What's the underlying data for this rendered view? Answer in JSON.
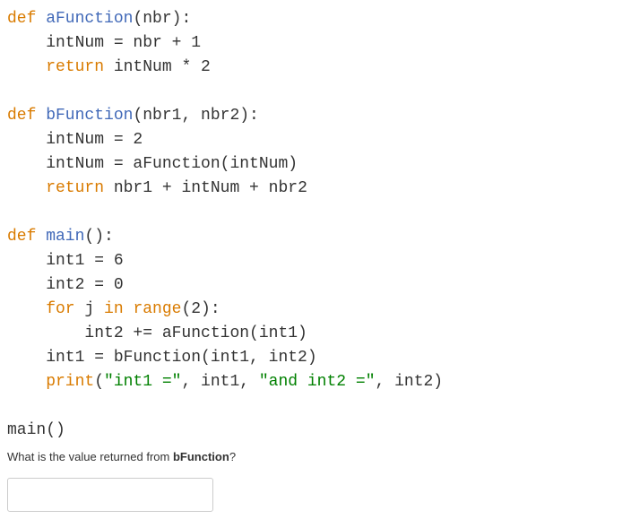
{
  "code": {
    "l1_def": "def",
    "l1_fn": " aFunction",
    "l1_rest": "(nbr):",
    "l2": "    intNum = nbr + 1",
    "l3_ret": "    return",
    "l3_rest": " intNum * 2",
    "l4": "",
    "l5_def": "def",
    "l5_fn": " bFunction",
    "l5_rest": "(nbr1, nbr2):",
    "l6": "    intNum = 2",
    "l7": "    intNum = aFunction(intNum)",
    "l8_ret": "    return",
    "l8_rest": " nbr1 + intNum + nbr2",
    "l9": "",
    "l10_def": "def",
    "l10_fn": " main",
    "l10_rest": "():",
    "l11": "    int1 = 6",
    "l12": "    int2 = 0",
    "l13_for": "    for",
    "l13_j": " j",
    "l13_in": " in",
    "l13_range": " range",
    "l13_rest": "(2):",
    "l14": "        int2 += aFunction(int1)",
    "l15": "    int1 = bFunction(int1, int2)",
    "l16_print": "    print",
    "l16_pa": "(",
    "l16_s1": "\"int1 =\"",
    "l16_c1": ", int1, ",
    "l16_s2": "\"and int2 =\"",
    "l16_c2": ", int2)",
    "l17": "",
    "l18": "main()"
  },
  "question": {
    "prefix": "What is the value returned from ",
    "bold": "bFunction",
    "suffix": "?"
  },
  "input": {
    "value": ""
  }
}
